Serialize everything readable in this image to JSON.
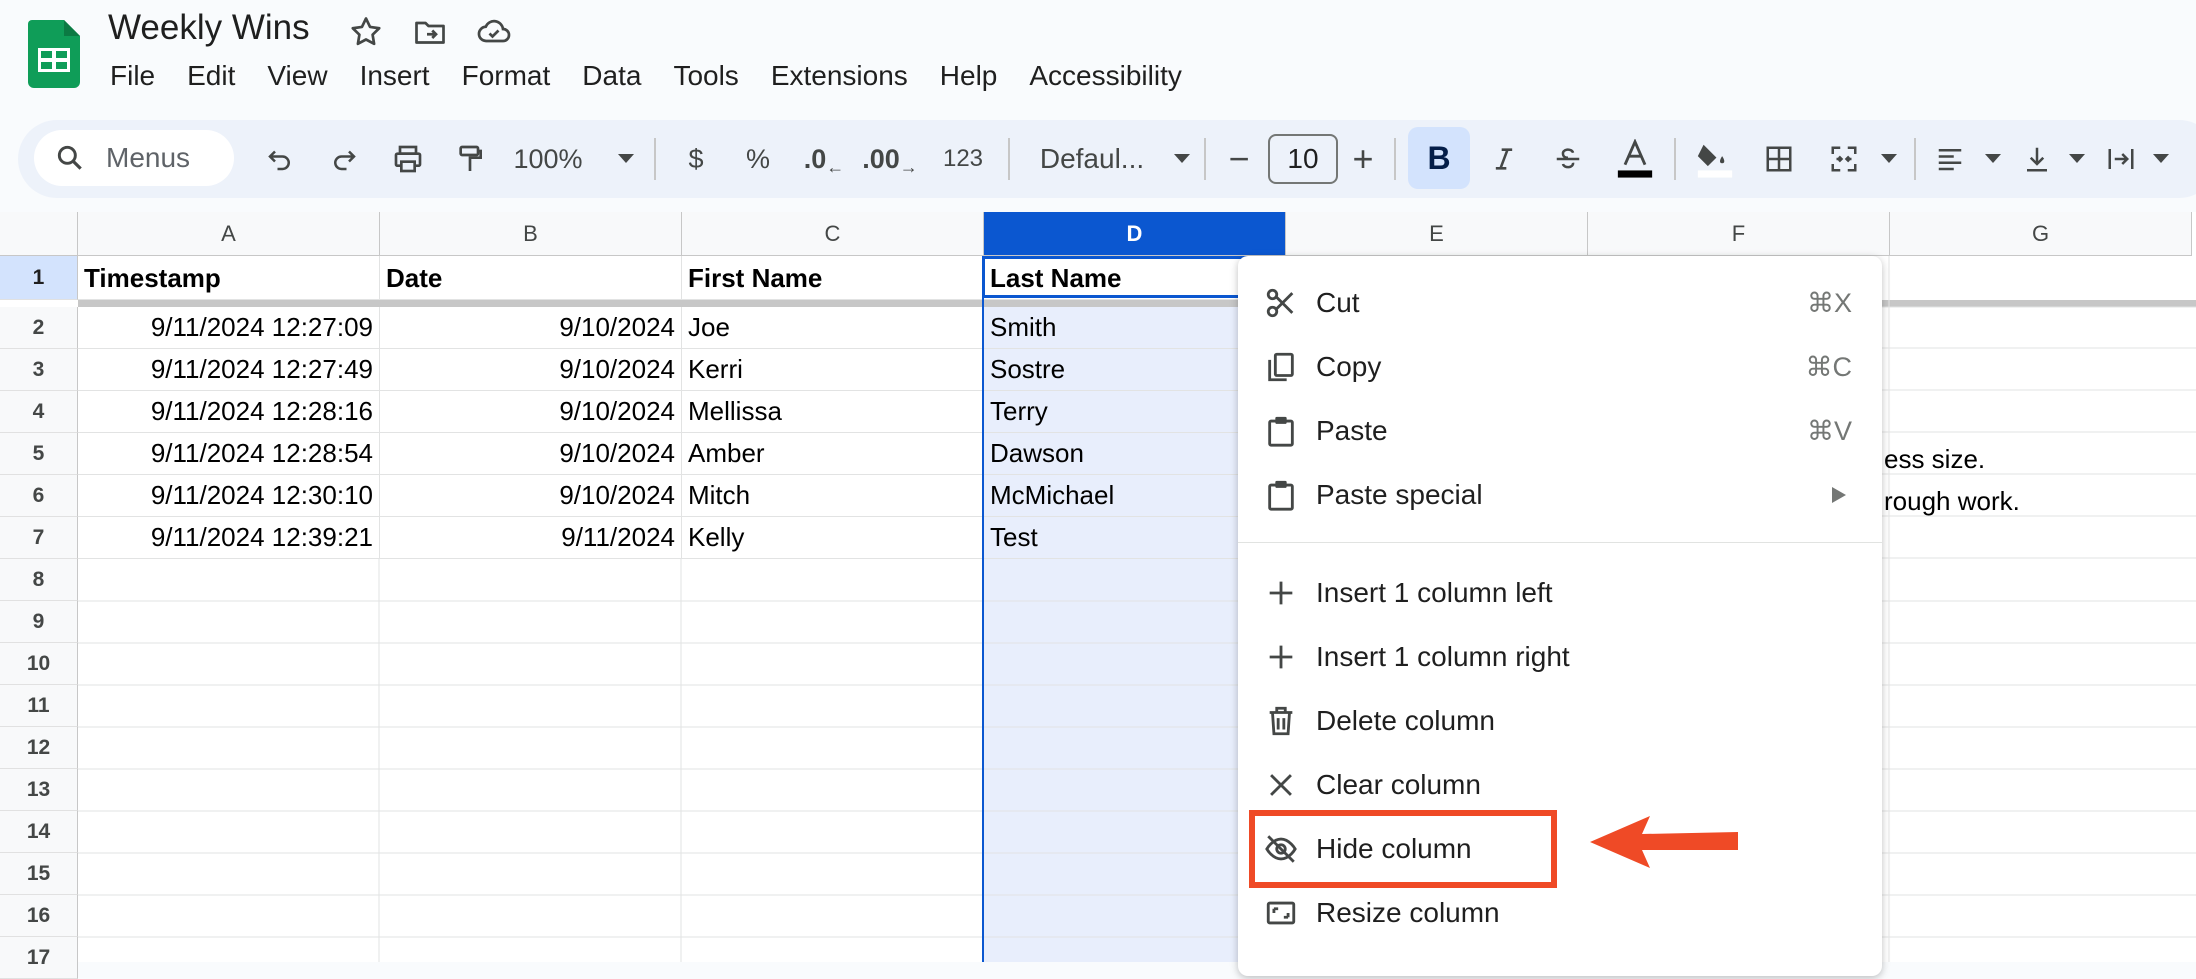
{
  "app": {
    "title": "Weekly Wins",
    "menus": [
      "File",
      "Edit",
      "View",
      "Insert",
      "Format",
      "Data",
      "Tools",
      "Extensions",
      "Help",
      "Accessibility"
    ]
  },
  "toolbar": {
    "search_label": "Menus",
    "zoom": "100%",
    "currency": "$",
    "percent": "%",
    "decrease_decimals": ".0",
    "increase_decimals": ".00",
    "number_format": "123",
    "font_name": "Defaul...",
    "font_size": "10",
    "bold": "B"
  },
  "grid": {
    "columns": [
      "A",
      "B",
      "C",
      "D",
      "E",
      "F",
      "G"
    ],
    "selected_column": "D",
    "row_numbers": [
      "1",
      "2",
      "3",
      "4",
      "5",
      "6",
      "7",
      "8",
      "9",
      "10",
      "11",
      "12",
      "13",
      "14",
      "15",
      "16",
      "17"
    ],
    "headers": [
      "Timestamp",
      "Date",
      "First Name",
      "Last Name"
    ],
    "rows": [
      {
        "timestamp": "9/11/2024 12:27:09",
        "date": "9/10/2024",
        "first": "Joe",
        "last": "Smith"
      },
      {
        "timestamp": "9/11/2024 12:27:49",
        "date": "9/10/2024",
        "first": "Kerri",
        "last": "Sostre"
      },
      {
        "timestamp": "9/11/2024 12:28:16",
        "date": "9/10/2024",
        "first": "Mellissa",
        "last": "Terry"
      },
      {
        "timestamp": "9/11/2024 12:28:54",
        "date": "9/10/2024",
        "first": "Amber",
        "last": "Dawson"
      },
      {
        "timestamp": "9/11/2024 12:30:10",
        "date": "9/10/2024",
        "first": "Mitch",
        "last": "McMichael"
      },
      {
        "timestamp": "9/11/2024 12:39:21",
        "date": "9/11/2024",
        "first": "Kelly",
        "last": "Test"
      }
    ],
    "overflow_row5": "ess size.",
    "overflow_row6": "rough work."
  },
  "context_menu": {
    "cut": {
      "label": "Cut",
      "shortcut": "⌘X"
    },
    "copy": {
      "label": "Copy",
      "shortcut": "⌘C"
    },
    "paste": {
      "label": "Paste",
      "shortcut": "⌘V"
    },
    "paste_special": {
      "label": "Paste special"
    },
    "insert_left": {
      "label": "Insert 1 column left"
    },
    "insert_right": {
      "label": "Insert 1 column right"
    },
    "delete_column": {
      "label": "Delete column"
    },
    "clear_column": {
      "label": "Clear column"
    },
    "hide_column": {
      "label": "Hide column"
    },
    "resize_column": {
      "label": "Resize column"
    }
  },
  "annotation": {
    "color": "#ef4a26"
  },
  "colors": {
    "accent": "#0b57d0",
    "selection": "#e8eefc",
    "sheets_green": "#0f9d58"
  }
}
